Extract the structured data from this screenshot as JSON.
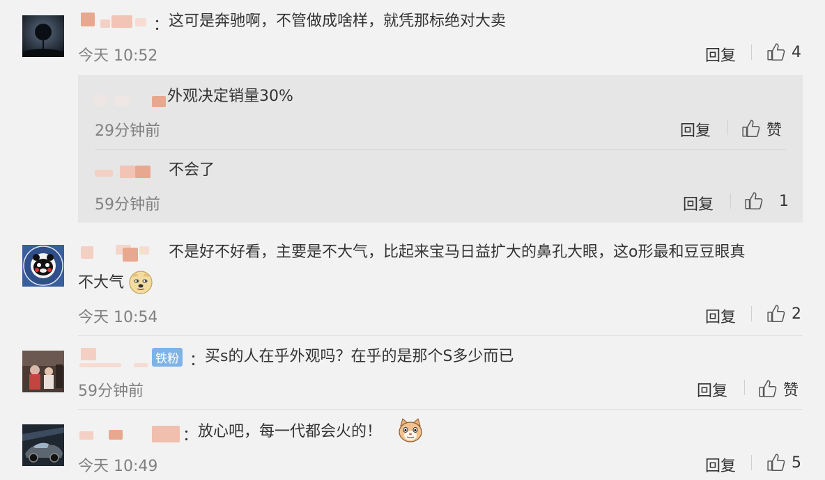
{
  "comments": [
    {
      "colon": "：",
      "text": "这可是奔驰啊，不管做成啥样，就凭那标绝对大卖",
      "time": "今天 10:52",
      "reply_label": "回复",
      "like_count": "4",
      "avatar_icon": "night-tree-avatar-icon",
      "sub_replies": [
        {
          "text": "外观决定销量30%",
          "time": "29分钟前",
          "reply_label": "回复",
          "like_label": "赞"
        },
        {
          "text": "不会了",
          "time": "59分钟前",
          "reply_label": "回复",
          "like_count": "1"
        }
      ]
    },
    {
      "text_line1": "不是好不好看，主要是不大气，比起来宝马日益扩大的鼻孔大眼，这o形最和豆豆眼真",
      "text_line2": "不大气",
      "time": "今天 10:54",
      "reply_label": "回复",
      "like_count": "2",
      "avatar_icon": "kumamon-badge-avatar-icon",
      "emoji_icon": "doge-emoji-icon"
    },
    {
      "badge": "铁粉",
      "colon": "：",
      "text": "买s的人在乎外观吗？在乎的是那个S多少而已",
      "time": "59分钟前",
      "reply_label": "回复",
      "like_label": "赞",
      "avatar_icon": "photo-avatar-icon"
    },
    {
      "colon": "：",
      "text": "放心吧，每一代都会火的！",
      "time": "今天 10:49",
      "reply_label": "回复",
      "like_count": "5",
      "avatar_icon": "car-avatar-icon",
      "emoji_icon": "cat-emoji-icon"
    }
  ],
  "colors": {
    "username_blur": "#e8a88f",
    "badge": "#7fb3e8",
    "time": "#808080",
    "background": "#f2f2f2"
  }
}
